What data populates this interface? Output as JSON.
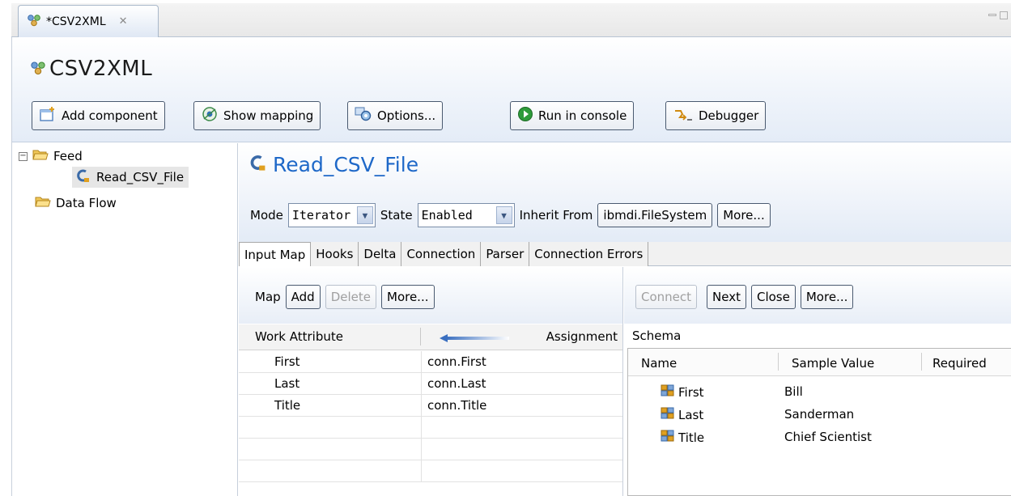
{
  "editor_tab": {
    "label": "*CSV2XML",
    "close": "✕"
  },
  "editor": {
    "title": "CSV2XML"
  },
  "toolbar": {
    "add_component": "Add component",
    "show_mapping": "Show mapping",
    "options": "Options...",
    "run_in_console": "Run in console",
    "debugger": "Debugger"
  },
  "tree": {
    "feed_expander": "−",
    "feed": "Feed",
    "read_csv_file": "Read_CSV_File",
    "data_flow": "Data Flow"
  },
  "component": {
    "title": "Read_CSV_File",
    "mode_label": "Mode",
    "mode_value": "Iterator",
    "state_label": "State",
    "state_value": "Enabled",
    "inherit_label": "Inherit From",
    "inherit_value": "ibmdi.FileSystem",
    "more": "More..."
  },
  "subtabs": [
    "Input Map",
    "Hooks",
    "Delta",
    "Connection",
    "Parser",
    "Connection Errors"
  ],
  "map": {
    "map_label": "Map",
    "add": "Add",
    "delete": "Delete",
    "more": "More...",
    "col_work_attribute": "Work Attribute",
    "col_assignment": "Assignment",
    "rows": [
      {
        "attr": "First",
        "assign": "conn.First"
      },
      {
        "attr": "Last",
        "assign": "conn.Last"
      },
      {
        "attr": "Title",
        "assign": "conn.Title"
      }
    ]
  },
  "schema": {
    "connect": "Connect",
    "next": "Next",
    "close": "Close",
    "more": "More...",
    "label": "Schema",
    "col_name": "Name",
    "col_sample": "Sample Value",
    "col_required": "Required",
    "rows": [
      {
        "name": "First",
        "sample": "Bill"
      },
      {
        "name": "Last",
        "sample": "Sanderman"
      },
      {
        "name": "Title",
        "sample": "Chief Scientist"
      }
    ]
  },
  "colors": {
    "accent_title": "#1e68c8",
    "run_icon": "#2e9b3a"
  }
}
